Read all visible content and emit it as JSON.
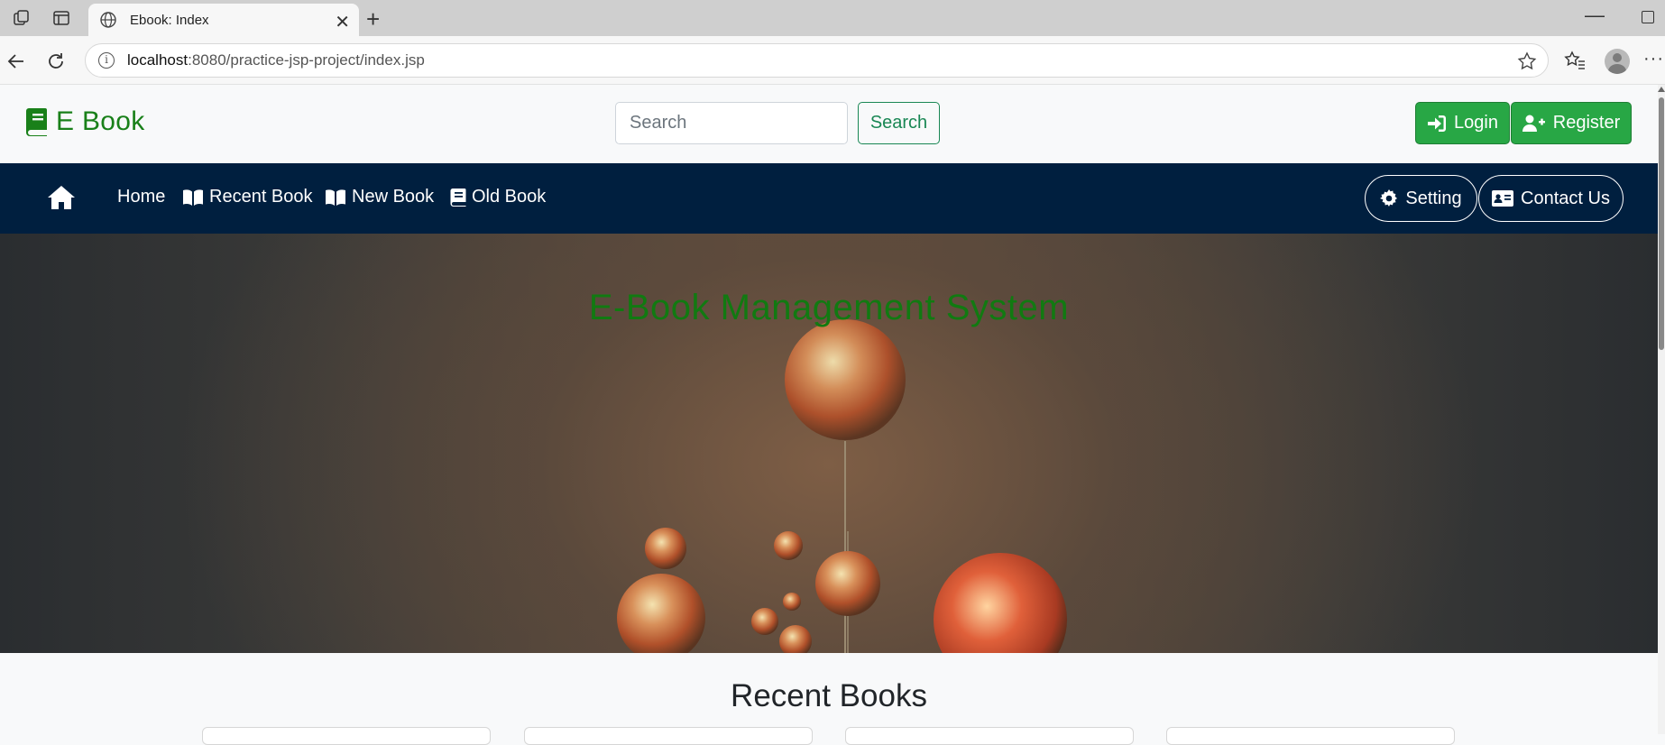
{
  "browser": {
    "tab_title": "Ebook: Index",
    "url_host": "localhost",
    "url_rest": ":8080/practice-jsp-project/index.jsp"
  },
  "header": {
    "brand": "E Book",
    "search_placeholder": "Search",
    "search_button": "Search",
    "login_button": "Login",
    "register_button": "Register"
  },
  "nav": {
    "items": [
      {
        "label": "Home"
      },
      {
        "label": "Recent Book",
        "icon": "book-open-icon"
      },
      {
        "label": "New Book",
        "icon": "book-open-icon"
      },
      {
        "label": "Old Book",
        "icon": "book-icon"
      }
    ],
    "setting_button": "Setting",
    "contact_button": "Contact Us"
  },
  "hero": {
    "title": "E-Book Management System"
  },
  "sections": {
    "recent_title": "Recent Books"
  },
  "colors": {
    "brand_green": "#198019",
    "button_green": "#28a745",
    "nav_bg": "#001f3f",
    "hero_title": "#117a11"
  }
}
